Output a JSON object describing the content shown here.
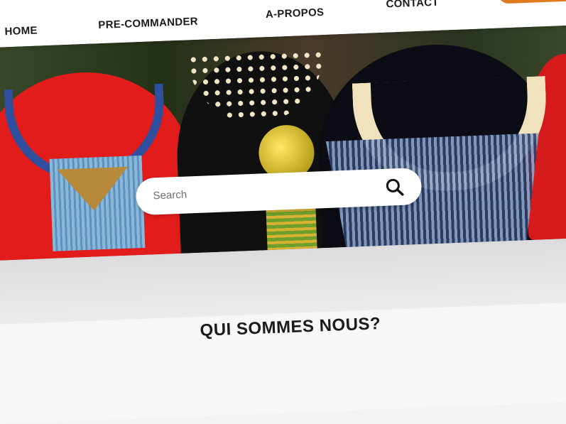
{
  "nav": {
    "items": [
      "HOME",
      "PRE-COMMANDER",
      "A-PROPOS",
      "CONTACT"
    ]
  },
  "search": {
    "placeholder": "Search"
  },
  "section": {
    "title": "QUI SOMMES NOUS?"
  },
  "colors": {
    "accent": "#e07a1f",
    "text": "#1b1b1b",
    "background": "#f7f7f7"
  },
  "icons": {
    "search": "search-icon"
  }
}
